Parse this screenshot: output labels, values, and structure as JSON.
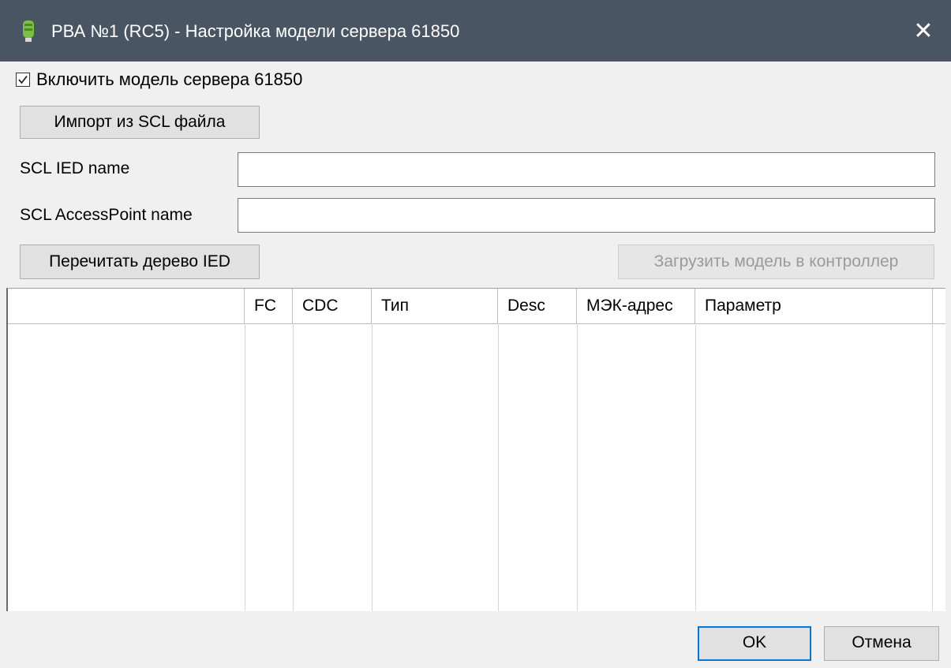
{
  "window": {
    "title": "РВА №1 (RC5) - Настройка модели сервера 61850",
    "close_glyph": "✕",
    "icon": "green-device-icon"
  },
  "enable_checkbox": {
    "label": "Включить модель сервера 61850",
    "checked": true
  },
  "buttons": {
    "import": "Импорт из SCL файла",
    "reread": "Перечитать дерево IED",
    "upload": "Загрузить модель в контроллер",
    "ok": "OK",
    "cancel": "Отмена"
  },
  "fields": {
    "ied_name": {
      "label": "SCL IED name",
      "value": ""
    },
    "access_point": {
      "label": "SCL AccessPoint name",
      "value": ""
    }
  },
  "table": {
    "columns": [
      "",
      "FC",
      "CDC",
      "Тип",
      "Desc",
      "МЭК-адрес",
      "Параметр"
    ],
    "rows": []
  },
  "colors": {
    "titlebar": "#4a5563",
    "focus_border": "#0078d7"
  }
}
